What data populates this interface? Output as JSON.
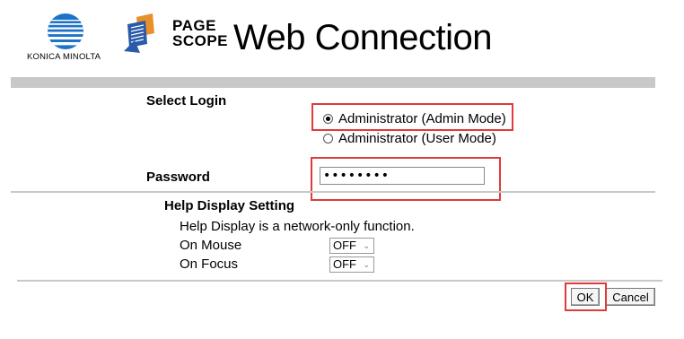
{
  "header": {
    "brand": "KONICA MINOLTA",
    "product_line1": "PAGE",
    "product_line2": "SCOPE",
    "title": "Web Connection"
  },
  "login": {
    "select_label": "Select Login",
    "options": [
      "Administrator (Admin Mode)",
      "Administrator (User Mode)"
    ],
    "selected_index": 0,
    "password_label": "Password",
    "password_value": "••••••••"
  },
  "help": {
    "title": "Help Display Setting",
    "description": "Help Display is a network-only function.",
    "on_mouse_label": "On Mouse",
    "on_mouse_value": "OFF",
    "on_focus_label": "On Focus",
    "on_focus_value": "OFF"
  },
  "buttons": {
    "ok": "OK",
    "cancel": "Cancel"
  },
  "colors": {
    "highlight": "#e03a3a",
    "separator": "#c8c8c8",
    "brand_blue": "#1b6ec2"
  }
}
